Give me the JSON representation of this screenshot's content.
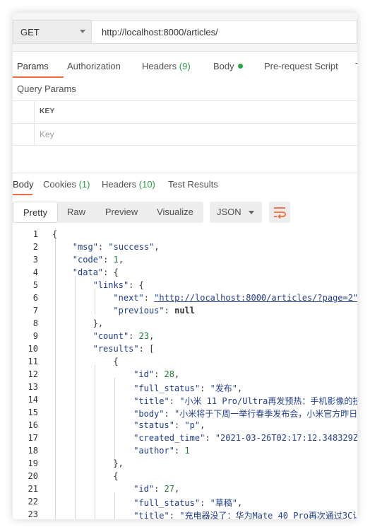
{
  "request": {
    "method": "GET",
    "url": "http://localhost:8000/articles/"
  },
  "request_tabs": [
    {
      "label": "Params"
    },
    {
      "label": "Authorization"
    },
    {
      "label": "Headers",
      "count": "(9)"
    },
    {
      "label": "Body"
    },
    {
      "label": "Pre-request Script"
    },
    {
      "label": "T"
    }
  ],
  "query_params": {
    "title": "Query Params",
    "key_header": "KEY",
    "key_placeholder": "Key"
  },
  "response_tabs": [
    {
      "label": "Body"
    },
    {
      "label": "Cookies",
      "count": "(1)"
    },
    {
      "label": "Headers",
      "count": "(10)"
    },
    {
      "label": "Test Results"
    }
  ],
  "view_modes": [
    "Pretty",
    "Raw",
    "Preview",
    "Visualize"
  ],
  "format": "JSON",
  "colors": {
    "accent": "#f26b3a",
    "status_green": "#2aa546"
  },
  "code_lines": [
    {
      "n": "1",
      "tokens": [
        {
          "t": "{",
          "c": "p"
        }
      ]
    },
    {
      "n": "2",
      "tokens": [
        {
          "t": "\"msg\"",
          "c": "k"
        },
        {
          "t": ": ",
          "c": "p"
        },
        {
          "t": "\"success\"",
          "c": "s"
        },
        {
          "t": ",",
          "c": "p"
        }
      ]
    },
    {
      "n": "3",
      "tokens": [
        {
          "t": "\"code\"",
          "c": "k"
        },
        {
          "t": ": ",
          "c": "p"
        },
        {
          "t": "1",
          "c": "n"
        },
        {
          "t": ",",
          "c": "p"
        }
      ]
    },
    {
      "n": "4",
      "tokens": [
        {
          "t": "\"data\"",
          "c": "k"
        },
        {
          "t": ": {",
          "c": "p"
        }
      ]
    },
    {
      "n": "5",
      "tokens": [
        {
          "t": "\"links\"",
          "c": "k"
        },
        {
          "t": ": {",
          "c": "p"
        }
      ]
    },
    {
      "n": "6",
      "tokens": [
        {
          "t": "\"next\"",
          "c": "k"
        },
        {
          "t": ": ",
          "c": "p"
        },
        {
          "t": "\"http://localhost:8000/articles/?page=2\"",
          "c": "lnk"
        }
      ]
    },
    {
      "n": "7",
      "tokens": [
        {
          "t": "\"previous\"",
          "c": "k"
        },
        {
          "t": ": ",
          "c": "p"
        },
        {
          "t": "null",
          "c": "nl"
        }
      ]
    },
    {
      "n": "8",
      "tokens": [
        {
          "t": "},",
          "c": "p"
        }
      ]
    },
    {
      "n": "9",
      "tokens": [
        {
          "t": "\"count\"",
          "c": "k"
        },
        {
          "t": ": ",
          "c": "p"
        },
        {
          "t": "23",
          "c": "n"
        },
        {
          "t": ",",
          "c": "p"
        }
      ]
    },
    {
      "n": "10",
      "tokens": [
        {
          "t": "\"results\"",
          "c": "k"
        },
        {
          "t": ": [",
          "c": "p"
        }
      ]
    },
    {
      "n": "11",
      "tokens": [
        {
          "t": "{",
          "c": "p"
        }
      ]
    },
    {
      "n": "12",
      "tokens": [
        {
          "t": "\"id\"",
          "c": "k"
        },
        {
          "t": ": ",
          "c": "p"
        },
        {
          "t": "28",
          "c": "n"
        },
        {
          "t": ",",
          "c": "p"
        }
      ]
    },
    {
      "n": "13",
      "tokens": [
        {
          "t": "\"full_status\"",
          "c": "k"
        },
        {
          "t": ": ",
          "c": "p"
        },
        {
          "t": "\"发布\"",
          "c": "s"
        },
        {
          "t": ",",
          "c": "p"
        }
      ]
    },
    {
      "n": "14",
      "tokens": [
        {
          "t": "\"title\"",
          "c": "k"
        },
        {
          "t": ": ",
          "c": "p"
        },
        {
          "t": "\"小米 11 Pro/Ultra再发预热：手机影像的技",
          "c": "s"
        }
      ]
    },
    {
      "n": "15",
      "tokens": [
        {
          "t": "\"body\"",
          "c": "k"
        },
        {
          "t": ": ",
          "c": "p"
        },
        {
          "t": "\"小米将于下周一举行春季发布会，小米官方昨日",
          "c": "s"
        }
      ]
    },
    {
      "n": "16",
      "tokens": [
        {
          "t": "\"status\"",
          "c": "k"
        },
        {
          "t": ": ",
          "c": "p"
        },
        {
          "t": "\"p\"",
          "c": "s"
        },
        {
          "t": ",",
          "c": "p"
        }
      ]
    },
    {
      "n": "17",
      "tokens": [
        {
          "t": "\"created_time\"",
          "c": "k"
        },
        {
          "t": ": ",
          "c": "p"
        },
        {
          "t": "\"2021-03-26T02:17:12.348329Z",
          "c": "s"
        }
      ]
    },
    {
      "n": "18",
      "tokens": [
        {
          "t": "\"author\"",
          "c": "k"
        },
        {
          "t": ": ",
          "c": "p"
        },
        {
          "t": "1",
          "c": "n"
        }
      ]
    },
    {
      "n": "19",
      "tokens": [
        {
          "t": "},",
          "c": "p"
        }
      ]
    },
    {
      "n": "20",
      "tokens": [
        {
          "t": "{",
          "c": "p"
        }
      ]
    },
    {
      "n": "21",
      "tokens": [
        {
          "t": "\"id\"",
          "c": "k"
        },
        {
          "t": ": ",
          "c": "p"
        },
        {
          "t": "27",
          "c": "n"
        },
        {
          "t": ",",
          "c": "p"
        }
      ]
    },
    {
      "n": "22",
      "tokens": [
        {
          "t": "\"full_status\"",
          "c": "k"
        },
        {
          "t": ": ",
          "c": "p"
        },
        {
          "t": "\"草稿\"",
          "c": "s"
        },
        {
          "t": ",",
          "c": "p"
        }
      ]
    },
    {
      "n": "23",
      "tokens": [
        {
          "t": "\"title\"",
          "c": "k"
        },
        {
          "t": ": ",
          "c": "p"
        },
        {
          "t": "\"充电器没了：华为Mate 40 Pro再次通过3C认",
          "c": "s"
        }
      ]
    }
  ]
}
